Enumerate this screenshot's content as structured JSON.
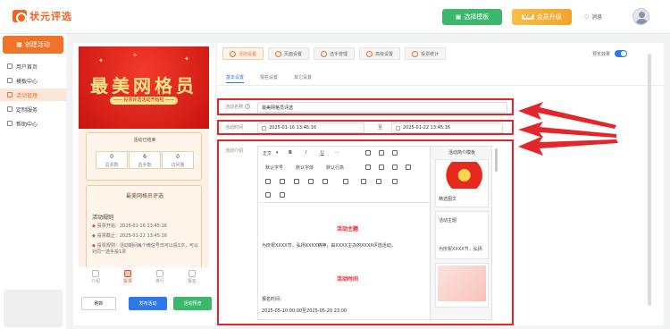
{
  "header": {
    "logo_text": "状元评选",
    "template_btn": "选择模板",
    "vip_tag": "VIP",
    "vip_btn": "会员升级",
    "message": "消息"
  },
  "sidebar": {
    "create_btn": "创建活动",
    "items": [
      {
        "label": "用户首页"
      },
      {
        "label": "模板中心"
      },
      {
        "label": "活动管理"
      },
      {
        "label": "定制服务"
      },
      {
        "label": "帮助中心"
      }
    ]
  },
  "preview": {
    "banner_title": "最美网格员",
    "banner_sub": "—— 投票评选活动开始啦 ——",
    "stat_title": "活动已结束",
    "stats": [
      {
        "num": "0",
        "label": "总票数"
      },
      {
        "num": "6",
        "label": "选手数"
      },
      {
        "num": "0",
        "label": "访问量"
      }
    ],
    "info_title": "最美网格员评选",
    "rules_title": "活动规则",
    "rule1": "投票开始：2025-01-16 13:45:16",
    "rule2": "投票截止：2025-01-22 13:45:16",
    "rule3": "投票规则：活动期间每个微信号日可以投1次，可以对同一选手投1票",
    "tabs": [
      {
        "label": "介绍"
      },
      {
        "label": "投票"
      },
      {
        "label": "排行"
      },
      {
        "label": "报名"
      }
    ],
    "btn_refresh": "刷新",
    "btn_publish": "发布活动",
    "btn_preview": "活动预览"
  },
  "main": {
    "tabs": [
      {
        "label": "活动设置"
      },
      {
        "label": "页面设置"
      },
      {
        "label": "选手管理"
      },
      {
        "label": "高级设置"
      },
      {
        "label": "投票统计"
      }
    ],
    "toggle_label": "预览效果",
    "subtabs": [
      {
        "label": "基本设置"
      },
      {
        "label": "报名设置"
      },
      {
        "label": "其它设置"
      }
    ],
    "name_label": "活动名称",
    "name_value": "最美网格员评选",
    "time_label": "活动时间",
    "time_start": "2025-01-16 13:45:16",
    "time_sep": "至",
    "time_end": "2025-01-22 13:45:16",
    "intro_label": "活动介绍",
    "toolbar": {
      "normal": "正文",
      "bold": "B",
      "italic": "I",
      "underline": "U",
      "more": "···",
      "font_family": "默认字号",
      "font_size": "默认字体",
      "line_height": "默认行高"
    },
    "editor_heading1": "活动主题",
    "editor_para1": "为庆祝XXXX节，弘扬XXXX精神，由XXXX主办的XXXX评选活动。",
    "editor_heading2": "活动时间",
    "editor_para2": "报名时间：",
    "editor_para3": "2025-05-10 00:00至2025-05-20 23:00"
  },
  "templates": {
    "title": "活动简介模板",
    "card1_caption": "精选图文",
    "card2_caption1": "活动主题",
    "card2_caption2": "为庆祝XXXX节，弘扬"
  }
}
